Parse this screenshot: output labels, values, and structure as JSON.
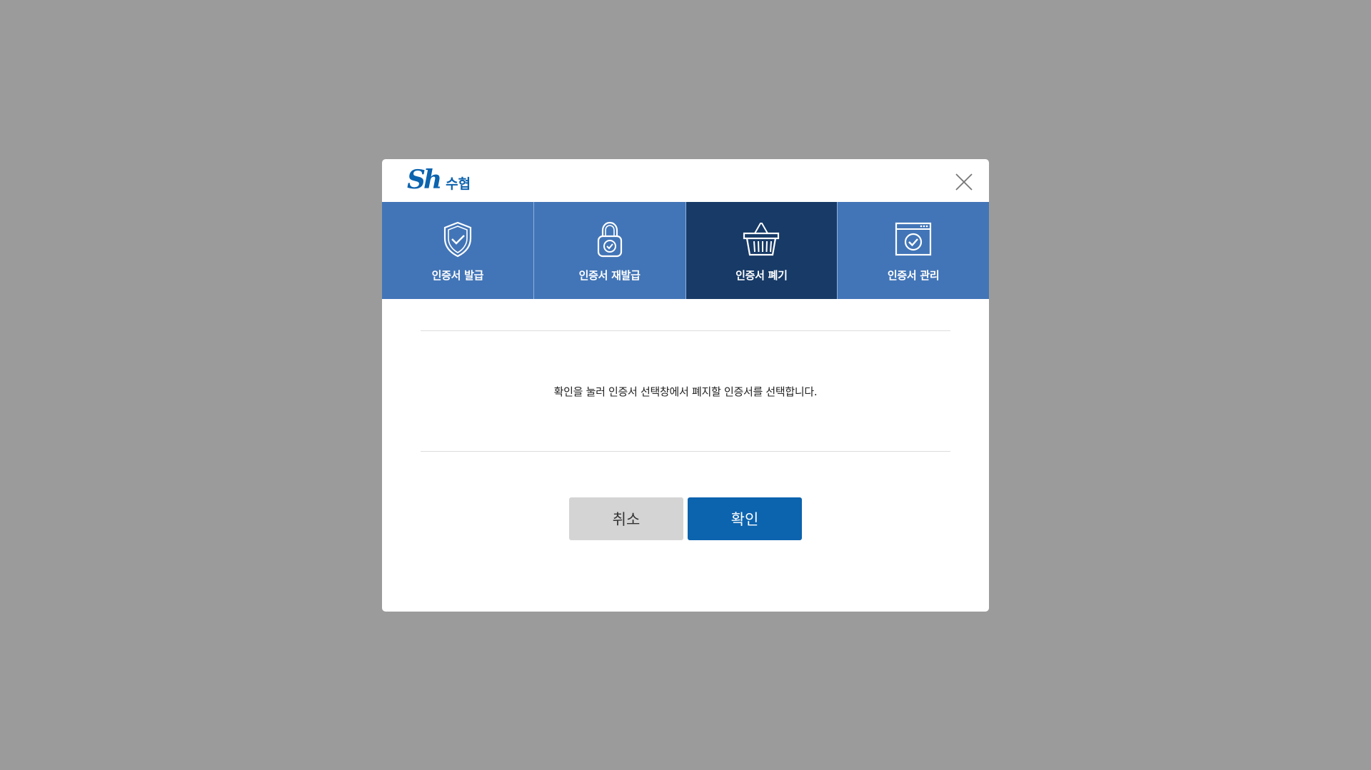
{
  "header": {
    "logo_mark": "Sh",
    "logo_text": "수협"
  },
  "tabs": [
    {
      "label": "인증서 발급",
      "icon": "shield-check-icon",
      "active": false
    },
    {
      "label": "인증서 재발급",
      "icon": "padlock-check-icon",
      "active": false
    },
    {
      "label": "인증서 폐기",
      "icon": "basket-icon",
      "active": true
    },
    {
      "label": "인증서 관리",
      "icon": "window-check-icon",
      "active": false
    }
  ],
  "content": {
    "message": "확인을 눌러 인증서 선택창에서 폐지할 인증서를 선택합니다."
  },
  "buttons": {
    "cancel_label": "취소",
    "ok_label": "확인"
  },
  "colors": {
    "brand": "#0c63ae",
    "tab_bg": "#4275b7",
    "tab_active_bg": "#173a67",
    "overlay": "#9b9b9b",
    "cancel_bg": "#d4d4d4"
  }
}
